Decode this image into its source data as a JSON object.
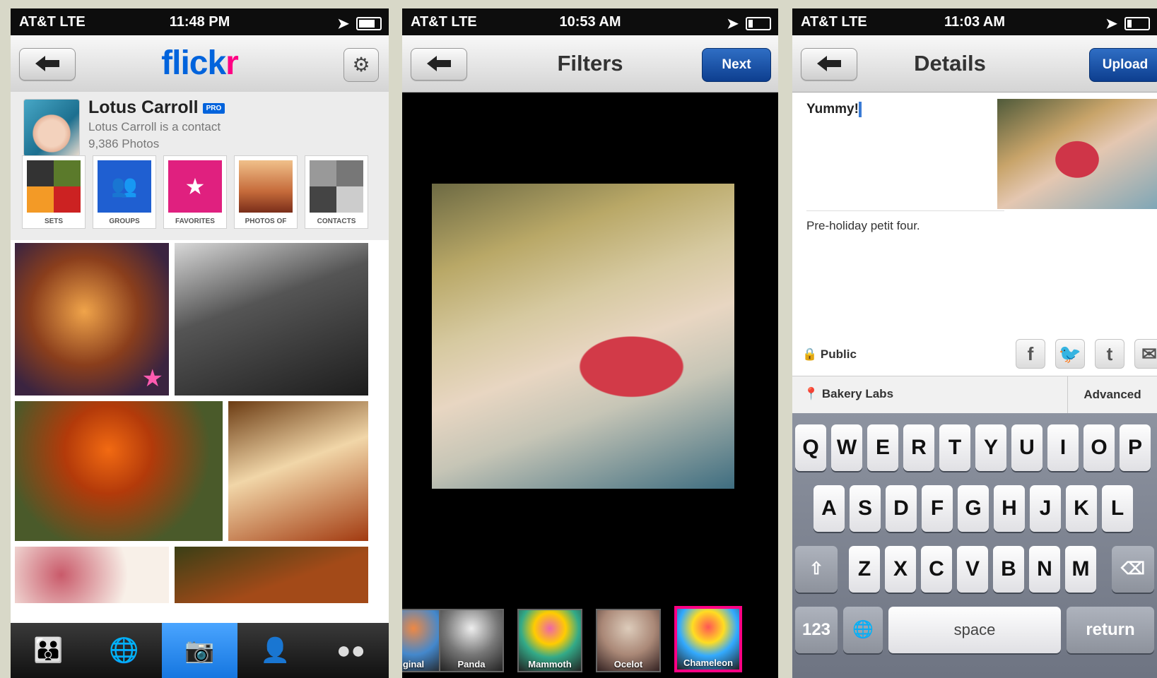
{
  "screen1": {
    "status": {
      "carrier": "AT&T  LTE",
      "time": "11:48 PM"
    },
    "logo": {
      "fl": "flick",
      "r": "r"
    },
    "profile": {
      "name": "Lotus Carroll",
      "badge": "PRO",
      "relation": "Lotus Carroll is a contact",
      "photos": "9,386 Photos"
    },
    "tiles": [
      "SETS",
      "GROUPS",
      "FAVORITES",
      "PHOTOS OF",
      "CONTACTS"
    ],
    "tabs": [
      "contacts-icon",
      "globe-icon",
      "camera-icon",
      "person-icon",
      "flickr-dots-icon"
    ]
  },
  "screen2": {
    "status": {
      "carrier": "AT&T  LTE",
      "time": "10:53 AM"
    },
    "title": "Filters",
    "next": "Next",
    "filters": [
      "ginal",
      "Panda",
      "Mammoth",
      "Ocelot",
      "Chameleon"
    ],
    "selected_filter": "Chameleon"
  },
  "screen3": {
    "status": {
      "carrier": "AT&T  LTE",
      "time": "11:03 AM"
    },
    "title": "Details",
    "upload": "Upload",
    "title_value": "Yummy!",
    "description": "Pre-holiday petit four.",
    "privacy": "Public",
    "share": [
      "f",
      "t",
      "t",
      "✉"
    ],
    "location": "Bakery Labs",
    "advanced": "Advanced",
    "keys_row1": [
      "Q",
      "W",
      "E",
      "R",
      "T",
      "Y",
      "U",
      "I",
      "O",
      "P"
    ],
    "keys_row2": [
      "A",
      "S",
      "D",
      "F",
      "G",
      "H",
      "J",
      "K",
      "L"
    ],
    "keys_row3": [
      "Z",
      "X",
      "C",
      "V",
      "B",
      "N",
      "M"
    ],
    "key_123": "123",
    "key_space": "space",
    "key_return": "return"
  }
}
